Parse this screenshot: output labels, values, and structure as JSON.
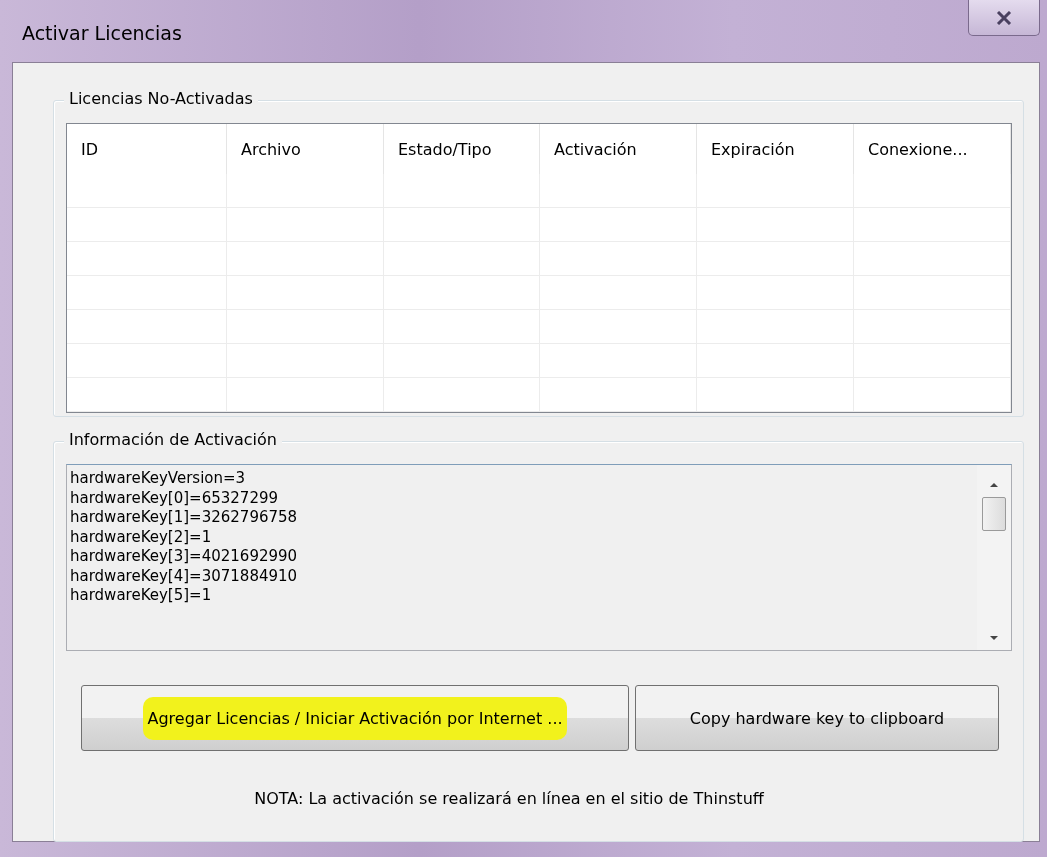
{
  "window": {
    "title": "Activar Licencias"
  },
  "licenses_group": {
    "title": "Licencias No-Activadas",
    "columns": [
      "ID",
      "Archivo",
      "Estado/Tipo",
      "Activación",
      "Expiración",
      "Conexione..."
    ]
  },
  "activation_group": {
    "title": "Información de Activación",
    "lines": [
      "hardwareKeyVersion=3",
      "hardwareKey[0]=65327299",
      "hardwareKey[1]=3262796758",
      "hardwareKey[2]=1",
      "hardwareKey[3]=4021692990",
      "hardwareKey[4]=3071884910",
      "hardwareKey[5]=1"
    ]
  },
  "buttons": [
    {
      "label": "Agregar Licencias / Iniciar Activación por Internet ...",
      "highlighted": true
    },
    {
      "label": "Copy hardware key to clipboard",
      "highlighted": false
    }
  ],
  "note": "NOTA: La activación se realizará en línea en el sitio de Thinstuff"
}
